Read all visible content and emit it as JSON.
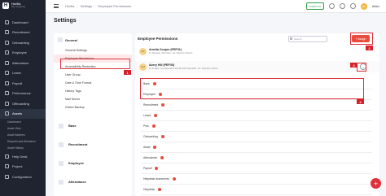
{
  "brand": {
    "name": "Horilla",
    "sub": "My company",
    "logo": "H"
  },
  "sidebar": {
    "items": [
      {
        "label": "Dashboard",
        "icon": "dashboard-icon"
      },
      {
        "label": "Recruitment",
        "icon": "recruitment-icon"
      },
      {
        "label": "Onboarding",
        "icon": "onboarding-icon"
      },
      {
        "label": "Employee",
        "icon": "employee-icon"
      },
      {
        "label": "Attendance",
        "icon": "attendance-icon"
      },
      {
        "label": "Leave",
        "icon": "leave-icon"
      },
      {
        "label": "Payroll",
        "icon": "payroll-icon"
      },
      {
        "label": "Performance",
        "icon": "performance-icon"
      },
      {
        "label": "Offboarding",
        "icon": "offboarding-icon"
      },
      {
        "label": "Assets",
        "icon": "assets-icon"
      }
    ],
    "sub_items": [
      "Dashboard",
      "Asset View",
      "Asset Batches",
      "Request and Allocation",
      "Asset History"
    ],
    "bottom_items": [
      {
        "label": "Help Desk",
        "icon": "help-desk-icon"
      },
      {
        "label": "Project",
        "icon": "project-icon"
      },
      {
        "label": "Configuration",
        "icon": "configuration-icon"
      }
    ]
  },
  "topbar": {
    "breadcrumbs": [
      "Horilla",
      "Settings",
      "Employee Permissions"
    ],
    "status_label": "CHECK IN",
    "user_initials": "AL",
    "user_name": "Adam"
  },
  "page": {
    "title": "Settings"
  },
  "settings_panel": {
    "general": {
      "title": "General",
      "items": [
        "General Settings",
        "Employee Permission",
        "Accessibility Restriction",
        "User Group",
        "Date & Time Format",
        "History Tags",
        "Mail Server",
        "Gdrive Backup"
      ]
    },
    "collapsed": [
      "Base",
      "Recruitment",
      "Employee",
      "Attendance"
    ]
  },
  "main": {
    "title": "Employee Permissions",
    "search_placeholder": "Search",
    "assign_label": "+ Assign",
    "employees": [
      {
        "initials": "AC",
        "name": "Amelia Cooper (PEP31)",
        "sub": "Sr. Manager / Recruiter - Ex: Days(3) in Marco"
      },
      {
        "initials": "AH",
        "name": "Avery Hill (PEP30)",
        "sub": "Sr. Analyst / Compensation and Benefits Specialist - Ex: Days(3) in Marco"
      }
    ],
    "permissions": [
      "Base",
      "Employee",
      "Recruitment",
      "Leave",
      "Pms",
      "Onboarding",
      "Asset",
      "Attendance",
      "Payroll",
      "Helpdesk documents",
      "Helpdesk"
    ]
  },
  "annotations": [
    "1",
    "2",
    "3",
    "4"
  ],
  "colors": {
    "accent": "#e74c3c",
    "annotation": "#d6202a",
    "sidebar_bg": "#1f2430"
  }
}
